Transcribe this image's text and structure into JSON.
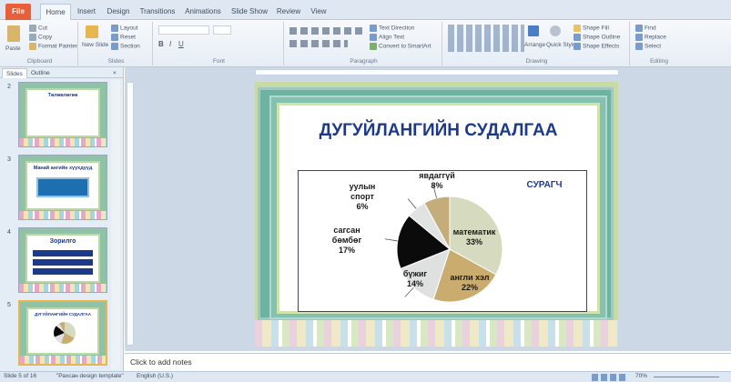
{
  "tabs": [
    "File",
    "Home",
    "Insert",
    "Design",
    "Transitions",
    "Animations",
    "Slide Show",
    "Review",
    "View"
  ],
  "ribbon": {
    "clipboard": {
      "paste": "Paste",
      "cut": "Cut",
      "copy": "Copy",
      "format_painter": "Format Painter",
      "label": "Clipboard"
    },
    "slides": {
      "new_slide": "New Slide",
      "layout": "Layout",
      "reset": "Reset",
      "section": "Section",
      "label": "Slides"
    },
    "font": {
      "label": "Font"
    },
    "paragraph": {
      "text_direction": "Text Direction",
      "align_text": "Align Text",
      "convert": "Convert to SmartArt",
      "label": "Paragraph"
    },
    "drawing": {
      "arrange": "Arrange",
      "quick_styles": "Quick Styles",
      "shape_fill": "Shape Fill",
      "shape_outline": "Shape Outline",
      "shape_effects": "Shape Effects",
      "label": "Drawing"
    },
    "editing": {
      "find": "Find",
      "replace": "Replace",
      "select": "Select",
      "label": "Editing"
    }
  },
  "pane": {
    "tabs": [
      "Slides",
      "Outline"
    ],
    "thumbs": [
      {
        "num": "2",
        "title": "Төлөвлөгөө"
      },
      {
        "num": "3",
        "title": "Манай ангийн хүүхдүүд"
      },
      {
        "num": "4",
        "title": "Зорилго"
      },
      {
        "num": "5",
        "title": "ДУГУЙЛАНГИЙН СУДАЛГАА"
      }
    ]
  },
  "slide": {
    "title": "ДУГУЙЛАНГИЙН СУДАЛГАА",
    "chart_label": "СУРАГЧ"
  },
  "chart_data": {
    "type": "pie",
    "title": "СУРАГЧ",
    "slices": [
      {
        "label": "математик",
        "value": 33,
        "color": "#d6dabf"
      },
      {
        "label": "англи хэл",
        "value": 22,
        "color": "#c9ac6e"
      },
      {
        "label": "бүжиг",
        "value": 14,
        "color": "#dfe1e0"
      },
      {
        "label": "сагсан бөмбөг",
        "value": 17,
        "color": "#0b0b0b"
      },
      {
        "label": "уулын спорт",
        "value": 6,
        "color": "#e1e3e2"
      },
      {
        "label": "явдаггүй",
        "value": 8,
        "color": "#c4ad7a"
      }
    ]
  },
  "notes": {
    "placeholder": "Click to add notes"
  },
  "status": {
    "slide": "Slide 5 of 16",
    "theme": "\"Рахсан design template\"",
    "lang": "English (U.S.)",
    "zoom": "70%"
  }
}
